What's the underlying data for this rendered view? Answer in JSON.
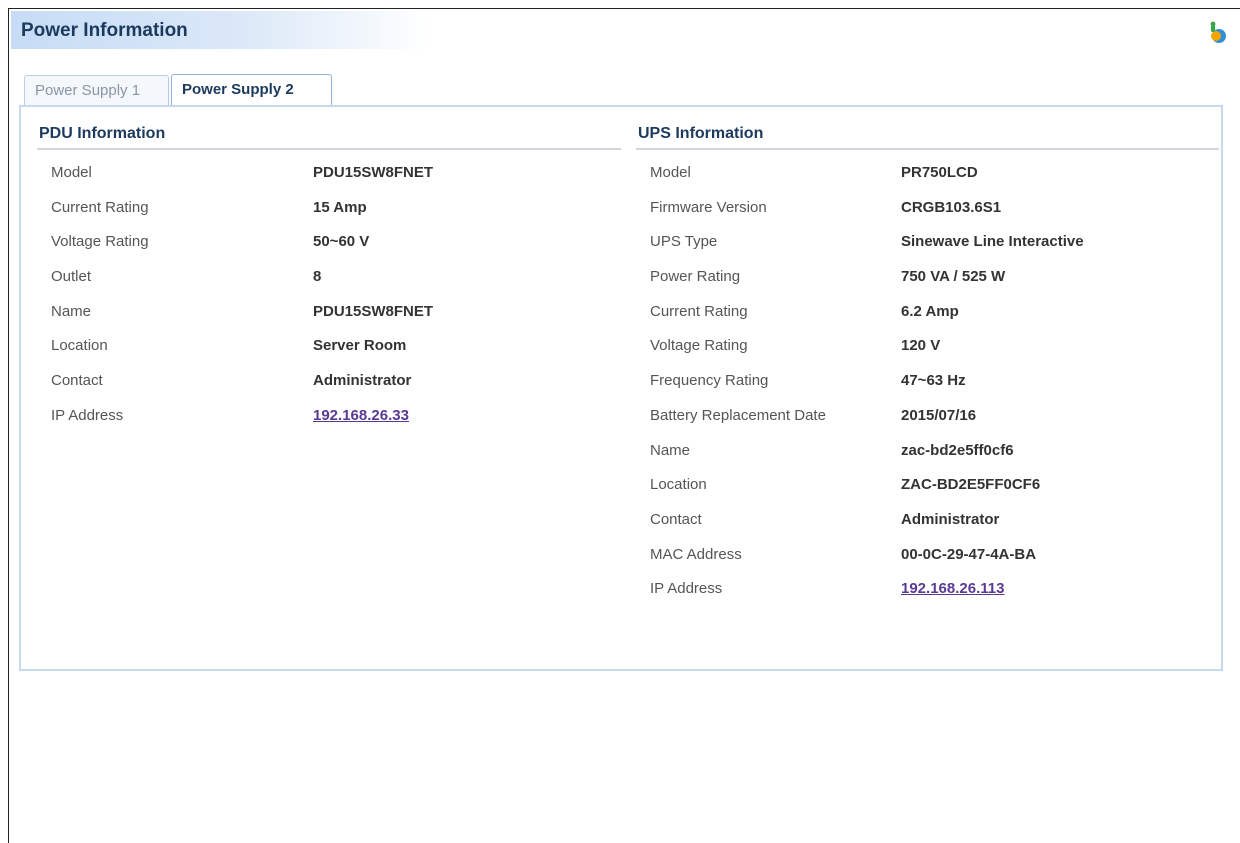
{
  "page": {
    "title": "Power Information"
  },
  "tabs": [
    {
      "label": "Power Supply 1",
      "active": false
    },
    {
      "label": "Power Supply 2",
      "active": true
    }
  ],
  "pdu": {
    "title": "PDU Information",
    "rows": [
      {
        "label": "Model",
        "value": "PDU15SW8FNET"
      },
      {
        "label": "Current Rating",
        "value": "15 Amp"
      },
      {
        "label": "Voltage Rating",
        "value": "50~60 V"
      },
      {
        "label": "Outlet",
        "value": "8"
      },
      {
        "label": "Name",
        "value": "PDU15SW8FNET"
      },
      {
        "label": "Location",
        "value": "Server Room"
      },
      {
        "label": "Contact",
        "value": "Administrator"
      },
      {
        "label": "IP Address",
        "value": "192.168.26.33"
      }
    ]
  },
  "ups": {
    "title": "UPS Information",
    "rows": [
      {
        "label": "Model",
        "value": "PR750LCD"
      },
      {
        "label": "Firmware Version",
        "value": "CRGB103.6S1"
      },
      {
        "label": "UPS Type",
        "value": "Sinewave Line Interactive"
      },
      {
        "label": "Power Rating",
        "value": "750 VA / 525 W"
      },
      {
        "label": "Current Rating",
        "value": "6.2 Amp"
      },
      {
        "label": "Voltage Rating",
        "value": "120 V"
      },
      {
        "label": "Frequency Rating",
        "value": "47~63 Hz"
      },
      {
        "label": "Battery Replacement Date",
        "value": "2015/07/16"
      },
      {
        "label": "Name",
        "value": "zac-bd2e5ff0cf6"
      },
      {
        "label": "Location",
        "value": "ZAC-BD2E5FF0CF6"
      },
      {
        "label": "Contact",
        "value": "Administrator"
      },
      {
        "label": "MAC Address",
        "value": "00-0C-29-47-4A-BA"
      },
      {
        "label": "IP Address",
        "value": "192.168.26.113"
      }
    ]
  },
  "icons": {
    "help": "help-icon"
  },
  "colors": {
    "title": "#1c3a5e",
    "link": "#5b3a93",
    "border": "#c7d9ef"
  }
}
